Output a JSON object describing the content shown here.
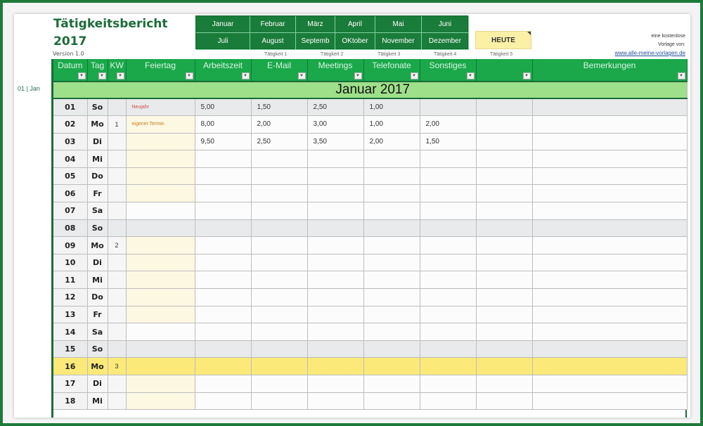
{
  "header": {
    "title_line1": "Tätigkeitsbericht",
    "title_line2": "2017",
    "version": "Version 1.0"
  },
  "months": [
    "Januar",
    "Februar",
    "März",
    "April",
    "Mai",
    "Juni",
    "Juli",
    "August",
    "Septemb",
    "OKtober",
    "November",
    "Dezember"
  ],
  "today_button": "HEUTE",
  "activity_labels": [
    "Tätigkeit 1",
    "Tätigkeit 2",
    "Tätigkeit 3",
    "Tätigkeit 4",
    "Tätigkeit 5"
  ],
  "promo": {
    "line1": "eine kostenlose",
    "line2": "Vorlage von:",
    "link": "www.alle-meine-vorlagen.de"
  },
  "row_label": "01 | Jan",
  "columns": [
    "Datum",
    "Tag",
    "KW",
    "Feiertag",
    "Arbeitszeit",
    "E-Mail",
    "Meetings",
    "Telefonate",
    "Sonstiges",
    "",
    "Bemerkungen"
  ],
  "month_band": "Januar 2017",
  "colors": {
    "header_green": "#1aa84b",
    "month_button_green": "#1a7c3a",
    "band_green": "#9ee08a",
    "today_yellow": "#fbe97a",
    "weekend_gray": "#e8eaeb"
  },
  "rows": [
    {
      "date": "01",
      "day": "So",
      "kw": "",
      "holiday": "Neujahr",
      "holiday_type": "red",
      "arbeitszeit": "5,00",
      "email": "1,50",
      "meetings": "2,50",
      "telefonate": "1,00",
      "sonstiges": "",
      "extra": "",
      "bemerkungen": "",
      "type": "weekend"
    },
    {
      "date": "02",
      "day": "Mo",
      "kw": "1",
      "holiday": "eigener Termin",
      "holiday_type": "orange",
      "arbeitszeit": "8,00",
      "email": "2,00",
      "meetings": "3,00",
      "telefonate": "1,00",
      "sonstiges": "2,00",
      "extra": "",
      "bemerkungen": "",
      "type": "weekday"
    },
    {
      "date": "03",
      "day": "Di",
      "kw": "",
      "holiday": "",
      "holiday_type": "",
      "arbeitszeit": "9,50",
      "email": "2,50",
      "meetings": "3,50",
      "telefonate": "2,00",
      "sonstiges": "1,50",
      "extra": "",
      "bemerkungen": "",
      "type": "weekday"
    },
    {
      "date": "04",
      "day": "Mi",
      "kw": "",
      "holiday": "",
      "holiday_type": "",
      "arbeitszeit": "",
      "email": "",
      "meetings": "",
      "telefonate": "",
      "sonstiges": "",
      "extra": "",
      "bemerkungen": "",
      "type": "weekday"
    },
    {
      "date": "05",
      "day": "Do",
      "kw": "",
      "holiday": "",
      "holiday_type": "",
      "arbeitszeit": "",
      "email": "",
      "meetings": "",
      "telefonate": "",
      "sonstiges": "",
      "extra": "",
      "bemerkungen": "",
      "type": "weekday"
    },
    {
      "date": "06",
      "day": "Fr",
      "kw": "",
      "holiday": "",
      "holiday_type": "",
      "arbeitszeit": "",
      "email": "",
      "meetings": "",
      "telefonate": "",
      "sonstiges": "",
      "extra": "",
      "bemerkungen": "",
      "type": "weekday"
    },
    {
      "date": "07",
      "day": "Sa",
      "kw": "",
      "holiday": "",
      "holiday_type": "",
      "arbeitszeit": "",
      "email": "",
      "meetings": "",
      "telefonate": "",
      "sonstiges": "",
      "extra": "",
      "bemerkungen": "",
      "type": "saturday"
    },
    {
      "date": "08",
      "day": "So",
      "kw": "",
      "holiday": "",
      "holiday_type": "",
      "arbeitszeit": "",
      "email": "",
      "meetings": "",
      "telefonate": "",
      "sonstiges": "",
      "extra": "",
      "bemerkungen": "",
      "type": "weekend"
    },
    {
      "date": "09",
      "day": "Mo",
      "kw": "2",
      "holiday": "",
      "holiday_type": "",
      "arbeitszeit": "",
      "email": "",
      "meetings": "",
      "telefonate": "",
      "sonstiges": "",
      "extra": "",
      "bemerkungen": "",
      "type": "weekday"
    },
    {
      "date": "10",
      "day": "Di",
      "kw": "",
      "holiday": "",
      "holiday_type": "",
      "arbeitszeit": "",
      "email": "",
      "meetings": "",
      "telefonate": "",
      "sonstiges": "",
      "extra": "",
      "bemerkungen": "",
      "type": "weekday"
    },
    {
      "date": "11",
      "day": "Mi",
      "kw": "",
      "holiday": "",
      "holiday_type": "",
      "arbeitszeit": "",
      "email": "",
      "meetings": "",
      "telefonate": "",
      "sonstiges": "",
      "extra": "",
      "bemerkungen": "",
      "type": "weekday"
    },
    {
      "date": "12",
      "day": "Do",
      "kw": "",
      "holiday": "",
      "holiday_type": "",
      "arbeitszeit": "",
      "email": "",
      "meetings": "",
      "telefonate": "",
      "sonstiges": "",
      "extra": "",
      "bemerkungen": "",
      "type": "weekday"
    },
    {
      "date": "13",
      "day": "Fr",
      "kw": "",
      "holiday": "",
      "holiday_type": "",
      "arbeitszeit": "",
      "email": "",
      "meetings": "",
      "telefonate": "",
      "sonstiges": "",
      "extra": "",
      "bemerkungen": "",
      "type": "weekday"
    },
    {
      "date": "14",
      "day": "Sa",
      "kw": "",
      "holiday": "",
      "holiday_type": "",
      "arbeitszeit": "",
      "email": "",
      "meetings": "",
      "telefonate": "",
      "sonstiges": "",
      "extra": "",
      "bemerkungen": "",
      "type": "saturday"
    },
    {
      "date": "15",
      "day": "So",
      "kw": "",
      "holiday": "",
      "holiday_type": "",
      "arbeitszeit": "",
      "email": "",
      "meetings": "",
      "telefonate": "",
      "sonstiges": "",
      "extra": "",
      "bemerkungen": "",
      "type": "weekend"
    },
    {
      "date": "16",
      "day": "Mo",
      "kw": "3",
      "holiday": "",
      "holiday_type": "",
      "arbeitszeit": "",
      "email": "",
      "meetings": "",
      "telefonate": "",
      "sonstiges": "",
      "extra": "",
      "bemerkungen": "",
      "type": "today"
    },
    {
      "date": "17",
      "day": "Di",
      "kw": "",
      "holiday": "",
      "holiday_type": "",
      "arbeitszeit": "",
      "email": "",
      "meetings": "",
      "telefonate": "",
      "sonstiges": "",
      "extra": "",
      "bemerkungen": "",
      "type": "weekday"
    },
    {
      "date": "18",
      "day": "Mi",
      "kw": "",
      "holiday": "",
      "holiday_type": "",
      "arbeitszeit": "",
      "email": "",
      "meetings": "",
      "telefonate": "",
      "sonstiges": "",
      "extra": "",
      "bemerkungen": "",
      "type": "weekday"
    }
  ]
}
